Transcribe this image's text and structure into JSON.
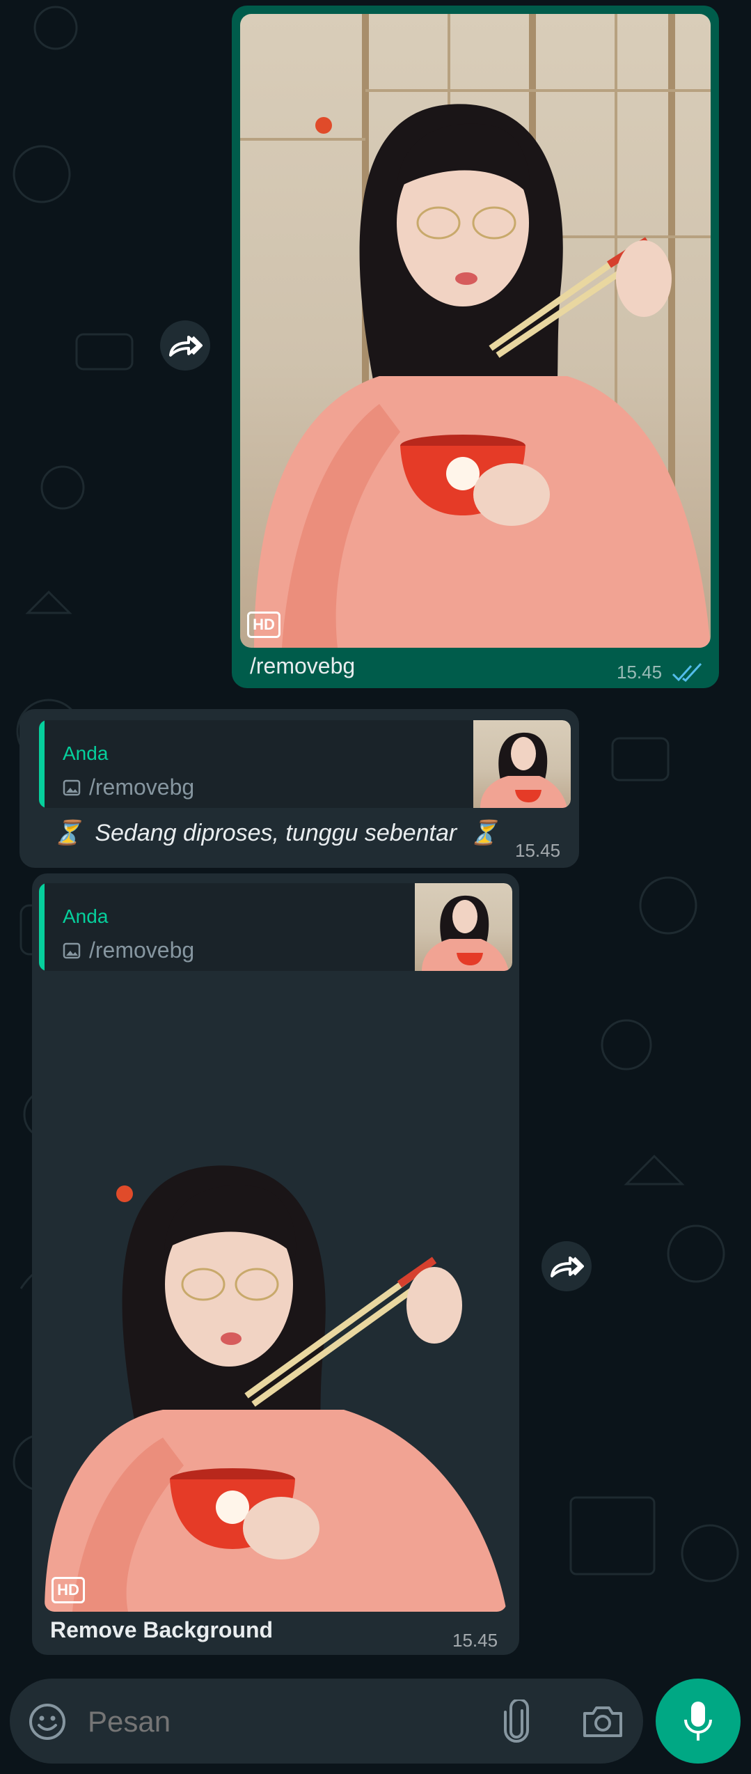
{
  "colors": {
    "background": "#0b141a",
    "outgoing_bubble": "#005c4b",
    "incoming_bubble": "#202c33",
    "accent": "#06cf9c",
    "read_ticks": "#53bdeb",
    "mic_button": "#00a884"
  },
  "messages": [
    {
      "direction": "outgoing",
      "media": "photo",
      "hd_badge": "HD",
      "caption": "/removebg",
      "time": "15.45",
      "status_icon": "double-check-read-icon"
    },
    {
      "direction": "incoming",
      "reply_to": {
        "author": "Anda",
        "preview_icon": "image-icon",
        "preview_text": "/removebg"
      },
      "text_prefix_icon": "⏳",
      "text": "Sedang diproses, tunggu sebentar",
      "text_suffix_icon": "⏳",
      "time": "15.45"
    },
    {
      "direction": "incoming",
      "reply_to": {
        "author": "Anda",
        "preview_icon": "image-icon",
        "preview_text": "/removebg"
      },
      "media": "photo-background-removed",
      "hd_badge": "HD",
      "caption": "Remove Background",
      "time": "15.45"
    }
  ],
  "composer": {
    "placeholder": "Pesan",
    "left_icon": "emoji-icon",
    "attach_icon": "paperclip-icon",
    "camera_icon": "camera-icon",
    "send_icon": "microphone-icon"
  }
}
